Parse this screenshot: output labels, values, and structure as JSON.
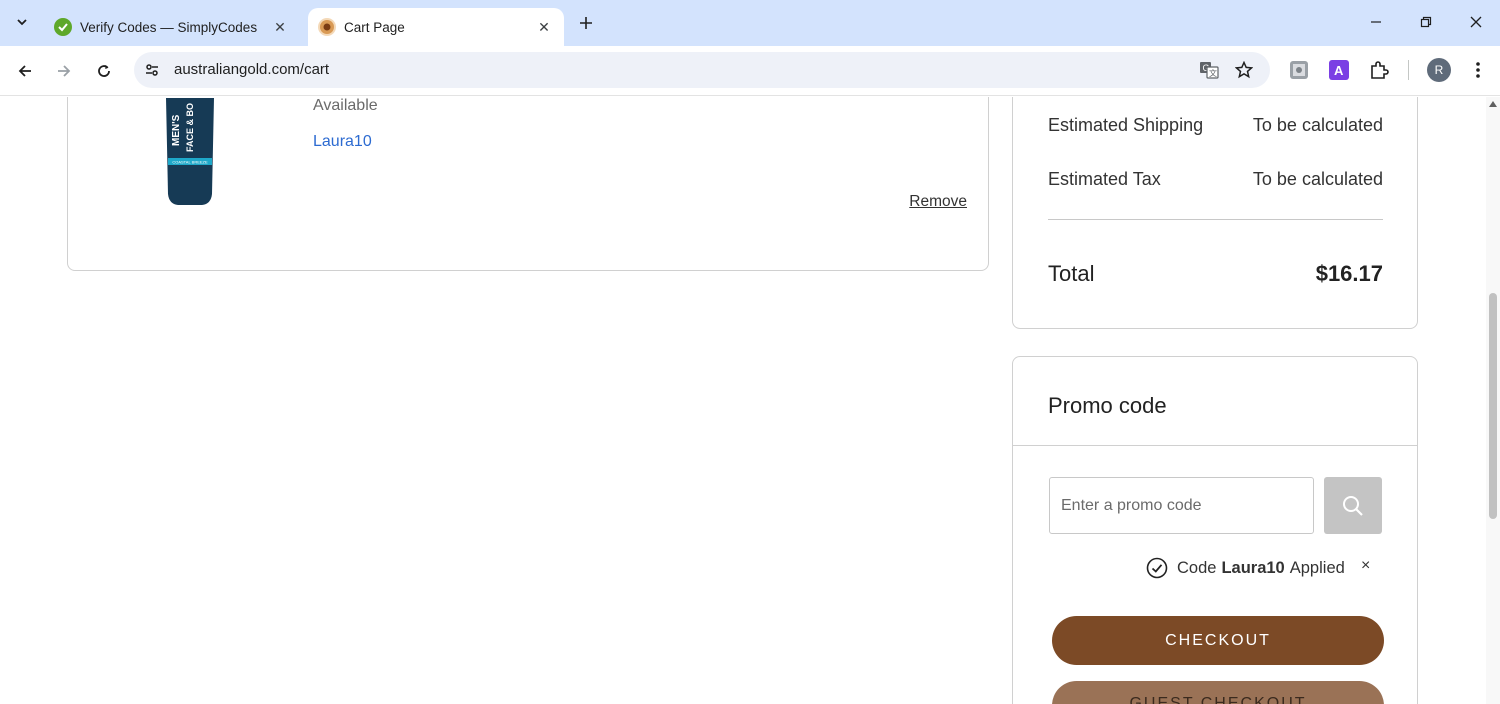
{
  "browser": {
    "tabs": [
      {
        "title": "Verify Codes — SimplyCodes",
        "favicon_color": "#5ea82a",
        "active": false
      },
      {
        "title": "Cart Page",
        "favicon_color": "#b06a2c",
        "active": true
      }
    ],
    "url": "australiangold.com/cart",
    "profile_initial": "R"
  },
  "cart_item": {
    "availability": "Available",
    "applied_code_link": "Laura10",
    "remove_label": "Remove",
    "product_image_text": {
      "line1": "MEN'S",
      "line2": "FACE & BO",
      "line3": "COASTAL BREEZE"
    }
  },
  "summary": {
    "shipping_label": "Estimated Shipping",
    "shipping_value": "To be calculated",
    "tax_label": "Estimated Tax",
    "tax_value": "To be calculated",
    "total_label": "Total",
    "total_value": "$16.17"
  },
  "promo": {
    "title": "Promo code",
    "placeholder": "Enter a promo code",
    "applied_prefix": "Code",
    "applied_code": "Laura10",
    "applied_suffix": "Applied",
    "remove_symbol": "×"
  },
  "buttons": {
    "checkout": "CHECKOUT",
    "guest_checkout": "GUEST CHECKOUT"
  },
  "colors": {
    "checkout_bg": "#7c4a26",
    "guest_bg": "#9a7256",
    "link": "#2d6bd1",
    "tabbar": "#d3e3fd"
  }
}
